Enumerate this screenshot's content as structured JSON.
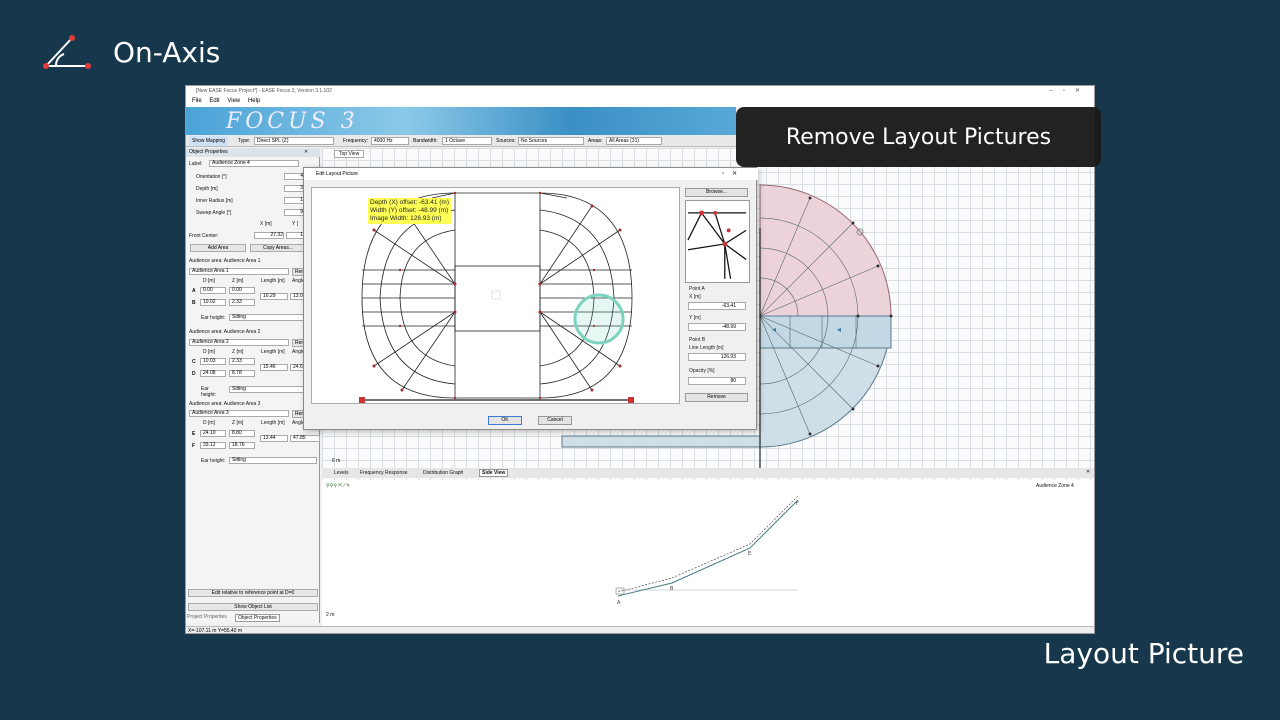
{
  "brand": {
    "title": "On-Axis"
  },
  "banner": {
    "text": "Remove Layout Pictures"
  },
  "caption": {
    "text": "Layout Picture"
  },
  "app": {
    "window_title": "[New EASE Focus Project*] - EASE Focus 3, Version 3.1.102",
    "menu": [
      "File",
      "Edit",
      "View",
      "Help"
    ],
    "logo": "FOCUS 3",
    "toolbar": {
      "show_mapping": "Show Mapping",
      "type_label": "Type:",
      "type_value": "Direct SPL (Z)",
      "frequency_label": "Frequency:",
      "frequency_value": "4000 Hz",
      "bandwidth_label": "Bandwidth:",
      "bandwidth_value": "1 Octave",
      "sources_label": "Sources:",
      "sources_value": "No Sources",
      "areas_label": "Areas:",
      "areas_value": "All Areas (31)"
    },
    "left_panel": {
      "header": "Object Properties",
      "label_caption": "Label:",
      "label_value": "Audience Zone 4",
      "fields": [
        {
          "name": "Orientation [°]",
          "value": "4"
        },
        {
          "name": "Depth [m]",
          "value": "3"
        },
        {
          "name": "Inner Radius [m]",
          "value": "1"
        },
        {
          "name": "Sweep Angle [°]",
          "value": "9"
        }
      ],
      "xy_header_x": "X [m]",
      "xy_header_y": "Y [",
      "front_center_label": "Front Center:",
      "front_center_x": "27.32",
      "front_center_y": "1",
      "add_area": "Add Area",
      "copy_areas": "Copy Areas...",
      "areas": [
        {
          "title": "Audience area: Audience Area 1",
          "name": "Audience Area 1",
          "rows": [
            {
              "pt": "A",
              "d": "0.00",
              "z": "0.00"
            },
            {
              "pt": "B",
              "d": "10.02",
              "z": "2.33"
            }
          ],
          "length": "10.29",
          "angle": "13.0"
        },
        {
          "title": "Audience area: Audience Area 2",
          "name": "Audience Area 2",
          "rows": [
            {
              "pt": "C",
              "d": "10.03",
              "z": "2.33"
            },
            {
              "pt": "D",
              "d": "24.08",
              "z": "8.78"
            }
          ],
          "length": "15.46",
          "angle": "24.6"
        },
        {
          "title": "Audience area: Audience Area 3",
          "name": "Audience Area 3",
          "rows": [
            {
              "pt": "E",
              "d": "24.10",
              "z": "8.80"
            },
            {
              "pt": "F",
              "d": "33.12",
              "z": "18.76"
            }
          ],
          "length": "13.44",
          "angle": "47.85"
        }
      ],
      "col_d": "D [m]",
      "col_z": "Z [m]",
      "col_length": "Length [m]",
      "col_angle": "Angle",
      "remove_short": "Rer",
      "ear_height_label": "Ear height:",
      "ear_height_value": "Sitting",
      "edit_relative": "Edit relative to reference point at D=0",
      "show_object_list": "Show Object List",
      "tab_project": "Project Properties",
      "tab_object": "Object Properties"
    },
    "view_tab": "Top View",
    "scale_top": "6 m",
    "bottom_tabs": [
      "Levels",
      "Frequency Response",
      "Distribution Graph",
      "Side View"
    ],
    "side_view_zone": "Audience Zone 4",
    "scale_bottom": "2 m",
    "side_points": [
      "A",
      "B",
      "E",
      "F"
    ],
    "status": "X=-107.11 m Y=55.40 m"
  },
  "dialog": {
    "title": "Edit Layout Picture",
    "info_lines": [
      "Depth (X) offset: -63.41 (m)",
      "Width (Y) offset: -48.99 (m)",
      "Image Width: 126.93 (m)"
    ],
    "browse": "Browse...",
    "point_a": "Point A",
    "x_label": "X [m]",
    "x_value": "-63.41",
    "y_label": "Y [m]",
    "y_value": "-48.99",
    "point_b": "Point B",
    "line_length_label": "Line Length [m]",
    "line_length_value": "126.93",
    "opacity_label": "Opacity [%]",
    "opacity_value": "80",
    "remove": "Remove",
    "ok": "OK",
    "cancel": "Cancel"
  }
}
